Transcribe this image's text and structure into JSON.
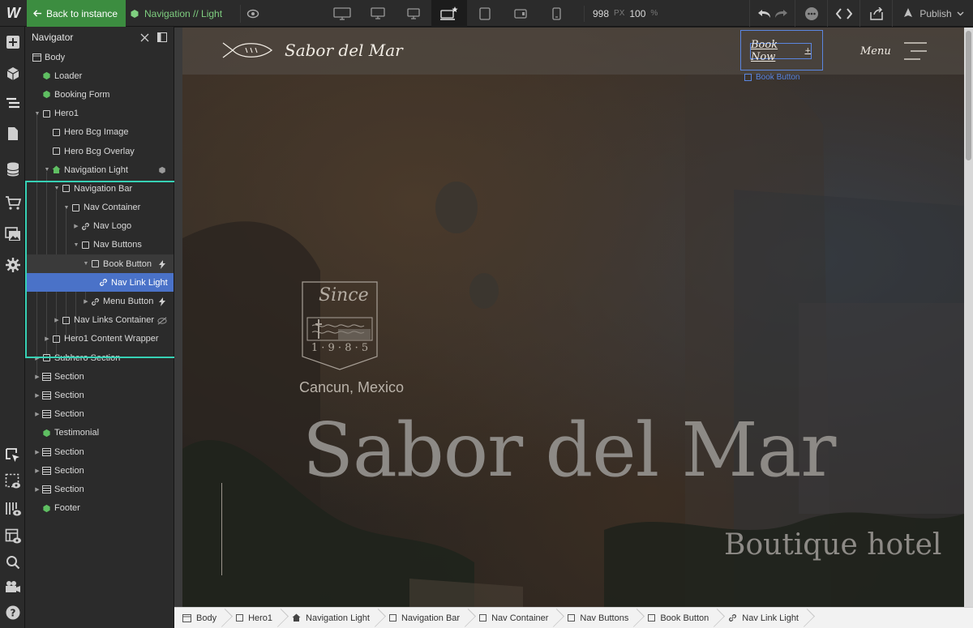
{
  "topbar": {
    "back_label": "Back to instance",
    "symbol_label": "Navigation // Light",
    "canvas_width": "998",
    "canvas_width_unit": "PX",
    "zoom": "100",
    "zoom_unit": "%",
    "publish_label": "Publish",
    "accent_color": "#3c8d40"
  },
  "navigator": {
    "title": "Navigator",
    "items": [
      {
        "label": "Body"
      },
      {
        "label": "Loader"
      },
      {
        "label": "Booking Form"
      },
      {
        "label": "Hero1"
      },
      {
        "label": "Hero Bcg Image"
      },
      {
        "label": "Hero Bcg Overlay"
      },
      {
        "label": "Navigation Light"
      },
      {
        "label": "Navigation Bar"
      },
      {
        "label": "Nav Container"
      },
      {
        "label": "Nav Logo"
      },
      {
        "label": "Nav Buttons"
      },
      {
        "label": "Book Button"
      },
      {
        "label": "Nav Link Light"
      },
      {
        "label": "Menu Button"
      },
      {
        "label": "Nav Links Container"
      },
      {
        "label": "Hero1 Content Wrapper"
      },
      {
        "label": "Subhero Section"
      },
      {
        "label": "Section"
      },
      {
        "label": "Section"
      },
      {
        "label": "Section"
      },
      {
        "label": "Testimonial"
      },
      {
        "label": "Section"
      },
      {
        "label": "Section"
      },
      {
        "label": "Section"
      },
      {
        "label": "Footer"
      }
    ],
    "selection_color": "#4a72c8",
    "focus_color": "#37d1b5"
  },
  "site": {
    "brand_name": "Sabor del Mar",
    "book_label": "Book Now",
    "book_element_label": "Book Button",
    "menu_label": "Menu",
    "badge_text": "Since",
    "badge_year": "1 · 9 · 8 · 5",
    "location": "Cancun, Mexico",
    "hero_title": "Sabor del Mar",
    "hero_subtitle": "Boutique hotel"
  },
  "breadcrumbs": [
    {
      "label": "Body"
    },
    {
      "label": "Hero1"
    },
    {
      "label": "Navigation Light"
    },
    {
      "label": "Navigation Bar"
    },
    {
      "label": "Nav Container"
    },
    {
      "label": "Nav Buttons"
    },
    {
      "label": "Book Button"
    },
    {
      "label": "Nav Link Light"
    }
  ]
}
